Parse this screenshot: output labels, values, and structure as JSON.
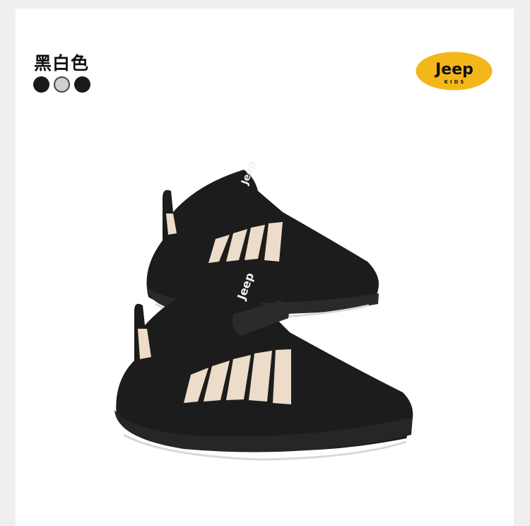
{
  "color_label": "黑白色",
  "swatches": [
    {
      "name": "black",
      "color": "#1a1a1a"
    },
    {
      "name": "gray",
      "color": "#cfcfcf"
    },
    {
      "name": "black",
      "color": "#1a1a1a"
    }
  ],
  "brand": {
    "logo_main": "Jeep",
    "logo_sub": "KIDS",
    "logo_color": "#f4b719",
    "heel_text": "Jeep"
  },
  "colors": {
    "shoe_body": "#1c1c1c",
    "stripe": "#ecdcc9",
    "sole_outline": "#d8d8d8"
  }
}
